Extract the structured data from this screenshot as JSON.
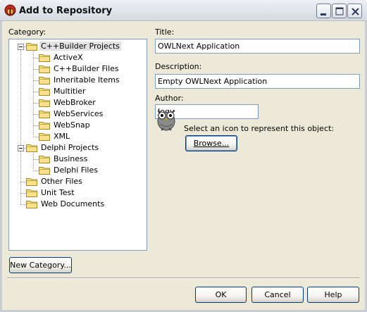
{
  "window": {
    "title": "Add to Repository"
  },
  "category": {
    "label": "Category:",
    "tree": [
      {
        "label": "C++Builder Projects",
        "level": 0,
        "expanded": true,
        "selected": true
      },
      {
        "label": "ActiveX",
        "level": 1
      },
      {
        "label": "C++Builder Files",
        "level": 1
      },
      {
        "label": "Inheritable Items",
        "level": 1
      },
      {
        "label": "Multitier",
        "level": 1
      },
      {
        "label": "WebBroker",
        "level": 1
      },
      {
        "label": "WebServices",
        "level": 1
      },
      {
        "label": "WebSnap",
        "level": 1
      },
      {
        "label": "XML",
        "level": 1
      },
      {
        "label": "Delphi Projects",
        "level": 0,
        "expanded": true
      },
      {
        "label": "Business",
        "level": 1
      },
      {
        "label": "Delphi Files",
        "level": 1
      },
      {
        "label": "Other Files",
        "level": 0
      },
      {
        "label": "Unit Test",
        "level": 0
      },
      {
        "label": "Web Documents",
        "level": 0
      }
    ]
  },
  "form": {
    "title_label": "Title:",
    "title_value": "OWLNext Application",
    "description_label": "Description:",
    "description_value": "Empty OWLNext Application",
    "author_label": "Author:",
    "author_value": "Jogy",
    "icon_prompt": "Select an icon to represent this object:",
    "browse_label": "Browse..."
  },
  "buttons": {
    "new_category": "New Category...",
    "ok": "OK",
    "cancel": "Cancel",
    "help": "Help"
  }
}
